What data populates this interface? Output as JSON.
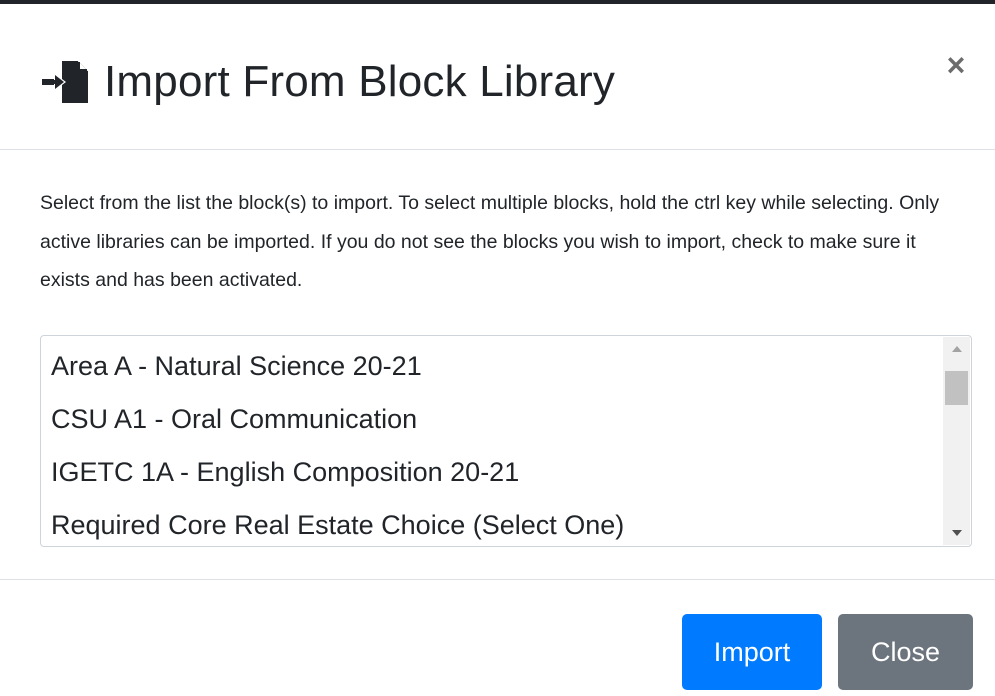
{
  "modal": {
    "title": "Import From Block Library",
    "close_symbol": "×",
    "instructions": "Select from the list the block(s) to import. To select multiple blocks, hold the ctrl key while selecting. Only active libraries can be imported. If you do not see the blocks you wish to import, check to make sure it exists and has been activated.",
    "list_items": [
      "Area A - Natural Science 20-21",
      "CSU A1 - Oral Communication",
      "IGETC 1A - English Composition 20-21",
      "Required Core Real Estate Choice (Select One)"
    ],
    "buttons": {
      "import_label": "Import",
      "close_label": "Close"
    },
    "icons": {
      "title_icon": "file-import-icon",
      "close_icon": "close-icon"
    },
    "colors": {
      "primary": "#007bff",
      "secondary": "#6c757d",
      "text": "#212529"
    }
  }
}
